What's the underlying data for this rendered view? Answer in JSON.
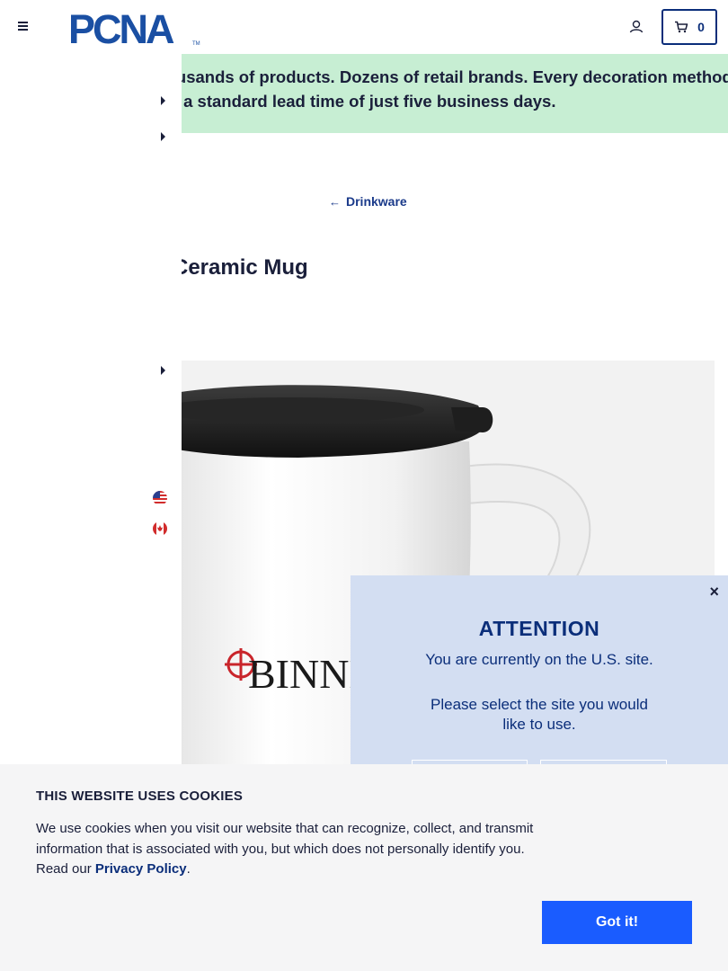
{
  "header": {
    "logo_text": "PCNA",
    "logo_mark": "TM",
    "cart_count": "0"
  },
  "banner": {
    "line1": "Thousands of products. Dozens of retail brands. Every decoration method. All",
    "line2": "with a standard lead time of just five business days."
  },
  "breadcrumb": {
    "arrow": "←",
    "label": "Drinkware"
  },
  "product": {
    "title": "Ceramic Mug",
    "imprint_text": "BINNE"
  },
  "modal": {
    "close": "×",
    "title": "ATTENTION",
    "current": "You are currently on the U.S. site.",
    "select": "Please select the site you would like to use."
  },
  "cookie": {
    "title": "THIS WEBSITE USES COOKIES",
    "text": "We use cookies when you visit our website that can recognize, collect, and transmit information that is associated with you, but which does not personally identify you. Read our ",
    "link": "Privacy Policy",
    "period": ".",
    "button": "Got it!"
  },
  "colors": {
    "brand": "#0b2e7a",
    "banner_bg": "#c7eed3",
    "modal_bg": "#d3def2",
    "button": "#1a5cff"
  }
}
